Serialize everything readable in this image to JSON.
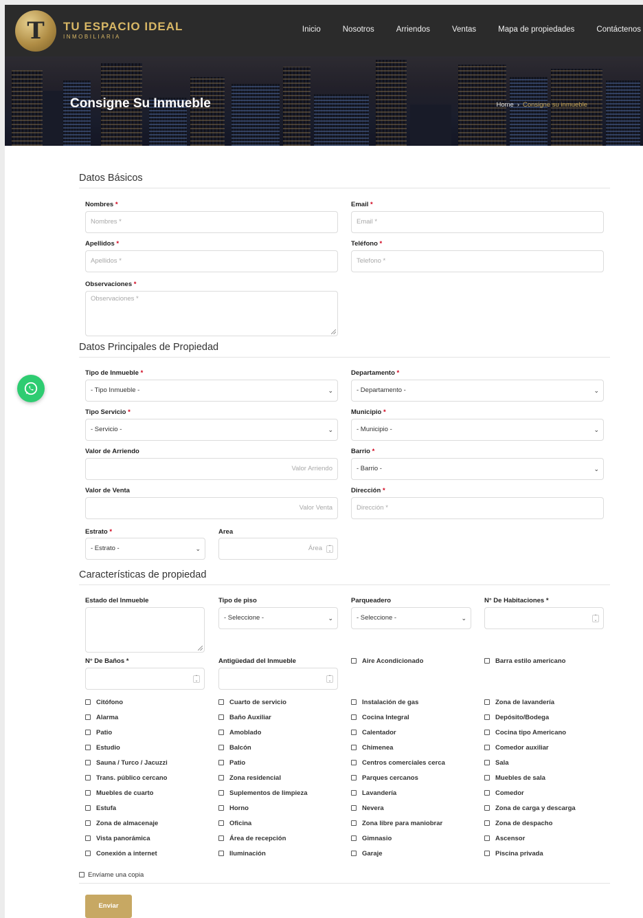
{
  "brand": {
    "name": "TU ESPACIO IDEAL",
    "tagline": "INMOBILIARIA",
    "monogram": "T"
  },
  "nav": [
    "Inicio",
    "Nosotros",
    "Arriendos",
    "Ventas",
    "Mapa de propiedades",
    "Contáctenos"
  ],
  "hero": {
    "title": "Consigne Su Inmueble",
    "breadcrumb_home": "Home",
    "breadcrumb_sep": "›",
    "breadcrumb_current": "Consigne su inmueble"
  },
  "required_mark": "*",
  "basic": {
    "title": "Datos Básicos",
    "nombres": {
      "label": "Nombres",
      "placeholder": "Nombres *"
    },
    "email": {
      "label": "Email",
      "placeholder": "Email *"
    },
    "apellidos": {
      "label": "Apellidos",
      "placeholder": "Apellidos *"
    },
    "telefono": {
      "label": "Teléfono",
      "placeholder": "Telefono *"
    },
    "observaciones": {
      "label": "Observaciones",
      "placeholder": "Observaciones *"
    }
  },
  "main": {
    "title": "Datos Principales de Propiedad",
    "tipo_inmueble": {
      "label": "Tipo de Inmueble",
      "value": "- Tipo Inmueble -"
    },
    "departamento": {
      "label": "Departamento",
      "value": "- Departamento -"
    },
    "tipo_servicio": {
      "label": "Tipo Servicio",
      "value": "- Servicio -"
    },
    "municipio": {
      "label": "Municipio",
      "value": "- Municipio -"
    },
    "valor_arriendo": {
      "label": "Valor de Arriendo",
      "placeholder": "Valor Arriendo"
    },
    "barrio": {
      "label": "Barrio",
      "value": "- Barrio -"
    },
    "valor_venta": {
      "label": "Valor de Venta",
      "placeholder": "Valor Venta"
    },
    "direccion": {
      "label": "Dirección",
      "placeholder": "Dirección *"
    },
    "estrato": {
      "label": "Estrato",
      "value": "- Estrato -"
    },
    "area": {
      "label": "Area",
      "placeholder": "Área"
    }
  },
  "features": {
    "title": "Características de propiedad",
    "estado": {
      "label": "Estado del Inmueble"
    },
    "tipo_piso": {
      "label": "Tipo de piso",
      "value": "- Seleccione -"
    },
    "parqueadero": {
      "label": "Parqueadero",
      "value": "- Seleccione -"
    },
    "habitaciones": {
      "label": "N° De Habitaciones *"
    },
    "banos": {
      "label": "N° De Baños *"
    },
    "antiguedad": {
      "label": "Antigüedad del Inmueble"
    },
    "top_checks": [
      "Aire Acondicionado",
      "Barra estilo americano"
    ],
    "checks": [
      [
        "Citófono",
        "Cuarto de servicio",
        "Instalación de gas",
        "Zona de lavandería"
      ],
      [
        "Alarma",
        "Baño Auxiliar",
        "Cocina Integral",
        "Depósito/Bodega"
      ],
      [
        "Patio",
        "Amoblado",
        "Calentador",
        "Cocina tipo Americano"
      ],
      [
        "Estudio",
        "Balcón",
        "Chimenea",
        "Comedor auxiliar"
      ],
      [
        "Sauna / Turco / Jacuzzi",
        "Patio",
        "Centros comerciales cerca",
        "Sala"
      ],
      [
        "Trans. público cercano",
        "Zona residencial",
        "Parques cercanos",
        "Muebles de sala"
      ],
      [
        "Muebles de cuarto",
        "Suplementos de limpieza",
        "Lavandería",
        "Comedor"
      ],
      [
        "Estufa",
        "Horno",
        "Nevera",
        "Zona de carga y descarga"
      ],
      [
        "Zona de almacenaje",
        "Oficina",
        "Zona libre para maniobrar",
        "Zona de despacho"
      ],
      [
        "Vista panorámica",
        "Área de recepción",
        "Gimnasio",
        "Ascensor"
      ],
      [
        "Conexión a internet",
        "Iluminación",
        "Garaje",
        "Piscina privada"
      ]
    ]
  },
  "copy_label": "Envíame una copia",
  "submit_label": "Enviar",
  "colors": {
    "header_bg": "#2b2b2b",
    "gold": "#c7a863",
    "whatsapp": "#2ecc71",
    "required": "#d0021b"
  }
}
